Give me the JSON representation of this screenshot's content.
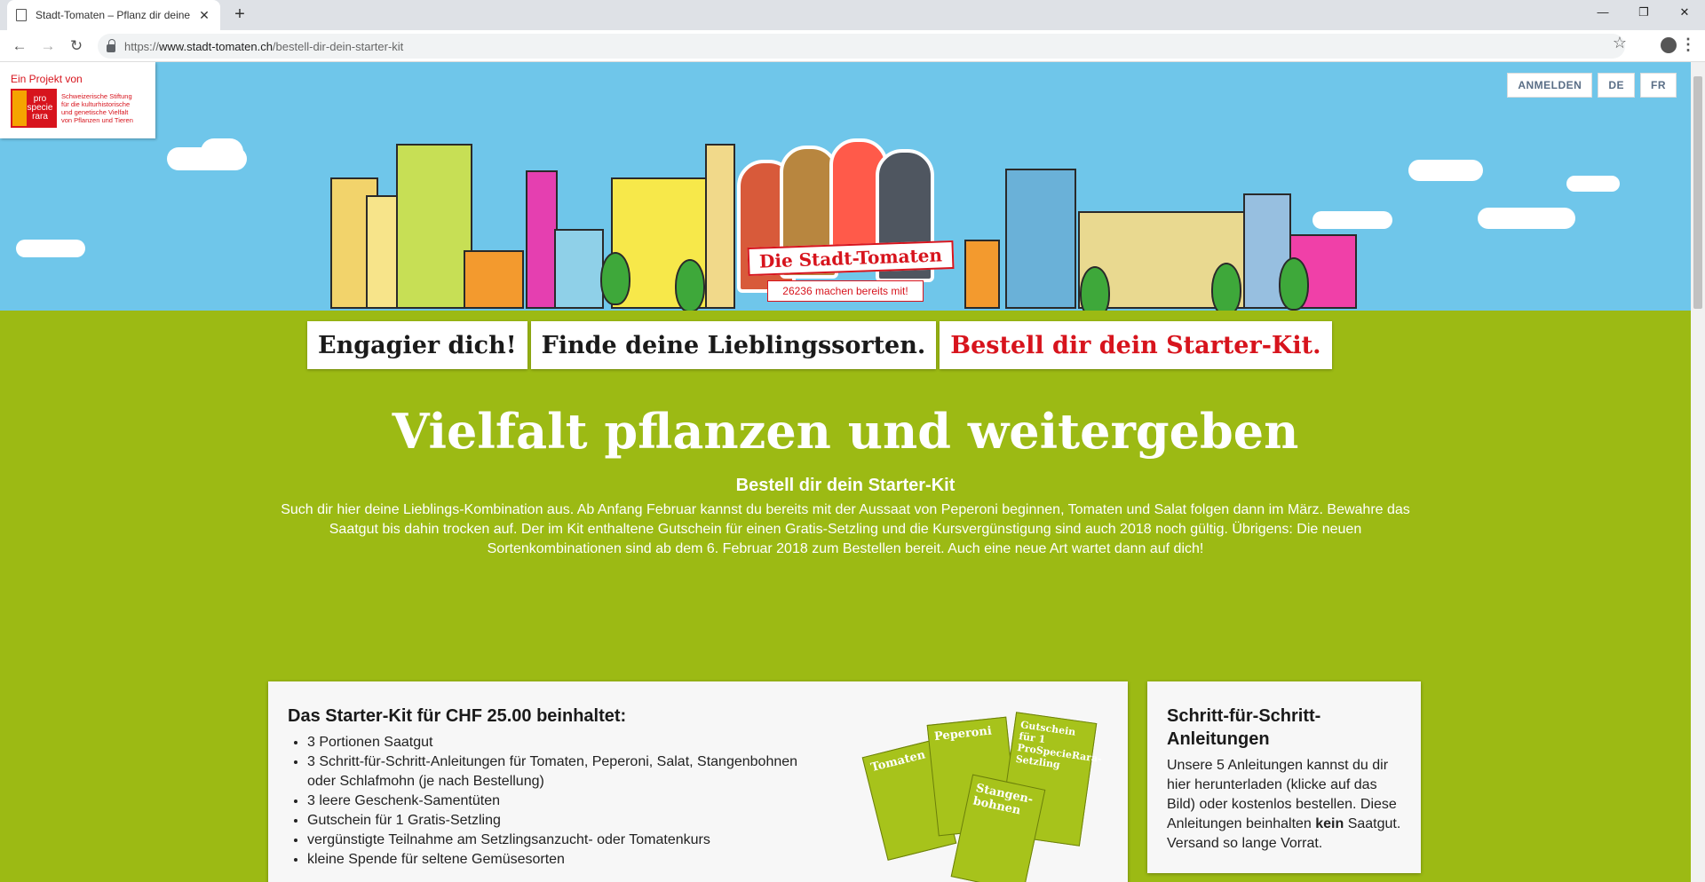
{
  "browser": {
    "tab_title": "Stadt-Tomaten – Pflanz dir deine",
    "url_prefix": "https://",
    "url_host": "www.stadt-tomaten.ch",
    "url_path": "/bestell-dir-dein-starter-kit"
  },
  "projekt": {
    "label": "Ein Projekt von",
    "logo_word_1": "pro",
    "logo_word_2": "specie",
    "logo_word_3": "rara",
    "logo_text_1": "Schweizerische Stiftung",
    "logo_text_2": "für die kulturhistorische",
    "logo_text_3": "und genetische Vielfalt",
    "logo_text_4": "von Pflanzen und Tieren"
  },
  "header_buttons": {
    "login": "ANMELDEN",
    "lang_de": "DE",
    "lang_fr": "FR"
  },
  "hero": {
    "banner": "Die Stadt-Tomaten",
    "counter": "26236 machen bereits mit!"
  },
  "nav": [
    {
      "label": "Engagier dich!"
    },
    {
      "label": "Finde deine Lieblingssorten."
    },
    {
      "label": "Bestell dir dein Starter-Kit."
    }
  ],
  "main": {
    "title": "Vielfalt pflanzen und weitergeben",
    "subtitle": "Bestell dir dein Starter-Kit",
    "intro": "Such dir hier deine Lieblings-Kombination aus. Ab Anfang Februar kannst du bereits mit der Aussaat von Peperoni beginnen, Tomaten und Salat folgen dann im März. Bewahre das Saatgut bis dahin trocken auf. Der im Kit enthaltene Gutschein für einen Gratis-Setzling und die Kursvergünstigung sind auch 2018 noch gültig. Übrigens: Die neuen Sortenkombinationen sind ab dem 6. Februar 2018 zum Bestellen bereit. Auch eine neue Art wartet dann auf dich!"
  },
  "kit_card": {
    "title": "Das Starter-Kit für CHF 25.00 beinhaltet:",
    "items": [
      "3 Portionen Saatgut",
      "3 Schritt-für-Schritt-Anleitungen für Tomaten, Peperoni, Salat, Stangenbohnen oder Schlafmohn (je nach Bestellung)",
      "3 leere Geschenk-Samentüten",
      "Gutschein für 1 Gratis-Setzling",
      "vergünstigte Teilnahme am Setzlingsanzucht- oder Tomatenkurs",
      "kleine Spende für seltene Gemüsesorten"
    ],
    "booklet_1": "Tomaten",
    "booklet_2": "Peperoni",
    "booklet_3": "Gutschein für 1 ProSpecieRara-Setzling",
    "booklet_4": "Stangen-bohnen"
  },
  "guide_card": {
    "title": "Schritt-für-Schritt-Anleitungen",
    "text_before": "Unsere 5 Anleitungen kannst du dir hier herunterladen (klicke auf das Bild) oder kostenlos bestellen. Diese Anleitungen beinhalten ",
    "text_bold": "kein",
    "text_after": " Saatgut. Versand so lange Vorrat."
  },
  "colors": {
    "accent_red": "#d7141d",
    "grass_green": "#9cba14",
    "sky_blue": "#6fc6ea"
  }
}
